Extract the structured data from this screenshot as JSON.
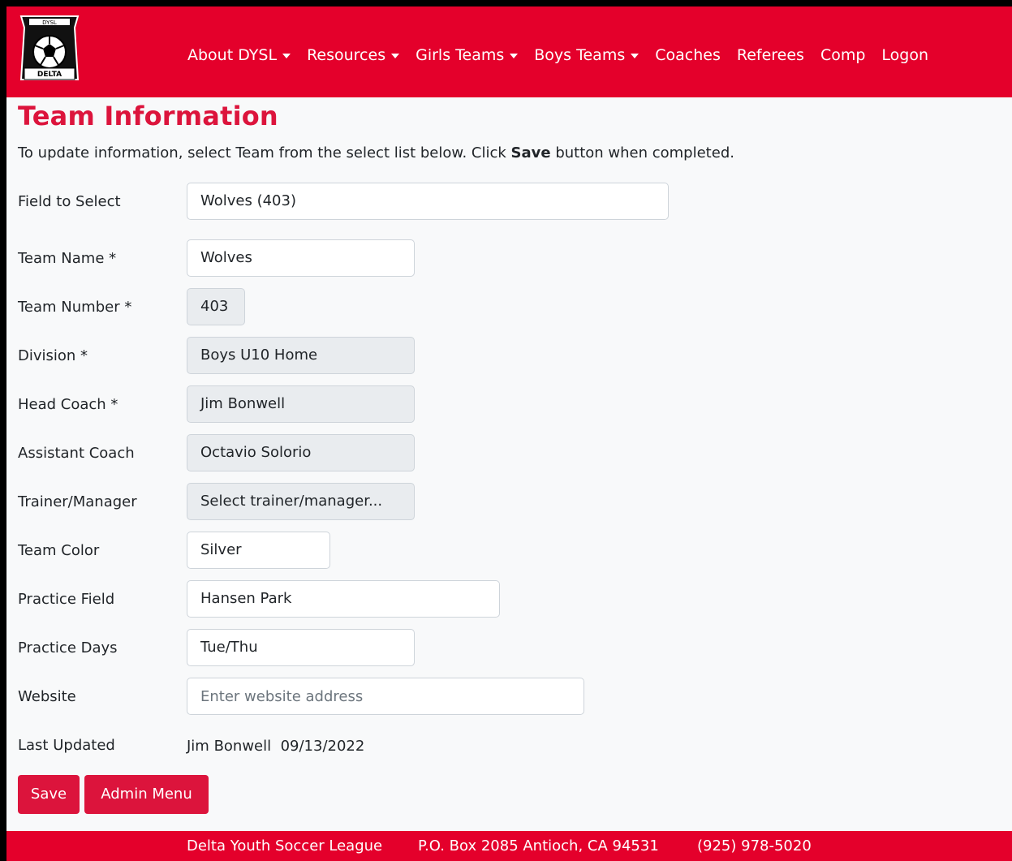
{
  "header": {
    "logo_alt": "DYSL Delta Youth Soccer League logo",
    "nav": [
      {
        "label": "About DYSL",
        "dropdown": true
      },
      {
        "label": "Resources",
        "dropdown": true
      },
      {
        "label": "Girls Teams",
        "dropdown": true
      },
      {
        "label": "Boys Teams",
        "dropdown": true
      },
      {
        "label": "Coaches",
        "dropdown": false
      },
      {
        "label": "Referees",
        "dropdown": false
      },
      {
        "label": "Comp",
        "dropdown": false
      },
      {
        "label": "Logon",
        "dropdown": false
      }
    ]
  },
  "page": {
    "title": "Team Information",
    "intro_before": "To update information, select Team from the select list below. Click ",
    "intro_bold": "Save",
    "intro_after": " button when completed."
  },
  "form": {
    "field_to_select": {
      "label": "Field to Select",
      "value": "Wolves (403)"
    },
    "team_name": {
      "label": "Team Name *",
      "value": "Wolves"
    },
    "team_number": {
      "label": "Team Number *",
      "value": "403"
    },
    "division": {
      "label": "Division *",
      "value": "Boys U10 Home"
    },
    "head_coach": {
      "label": "Head Coach *",
      "value": "Jim Bonwell"
    },
    "assistant_coach": {
      "label": "Assistant Coach",
      "value": "Octavio Solorio"
    },
    "trainer_manager": {
      "label": "Trainer/Manager",
      "value": "Select trainer/manager..."
    },
    "team_color": {
      "label": "Team Color",
      "value": "Silver"
    },
    "practice_field": {
      "label": "Practice Field",
      "value": "Hansen Park"
    },
    "practice_days": {
      "label": "Practice Days",
      "value": "Tue/Thu"
    },
    "website": {
      "label": "Website",
      "value": "",
      "placeholder": "Enter website address"
    },
    "last_updated": {
      "label": "Last Updated",
      "value": "Jim Bonwell  09/13/2022"
    }
  },
  "buttons": {
    "save": "Save",
    "admin_menu": "Admin Menu"
  },
  "footer": {
    "league": "Delta Youth Soccer League",
    "address": "P.O. Box 2085 Antioch, CA 94531",
    "phone": "(925) 978-5020"
  },
  "colors": {
    "brand_red": "#e4002b",
    "heading_red": "#dc143c",
    "disabled_bg": "#e9ecef"
  }
}
